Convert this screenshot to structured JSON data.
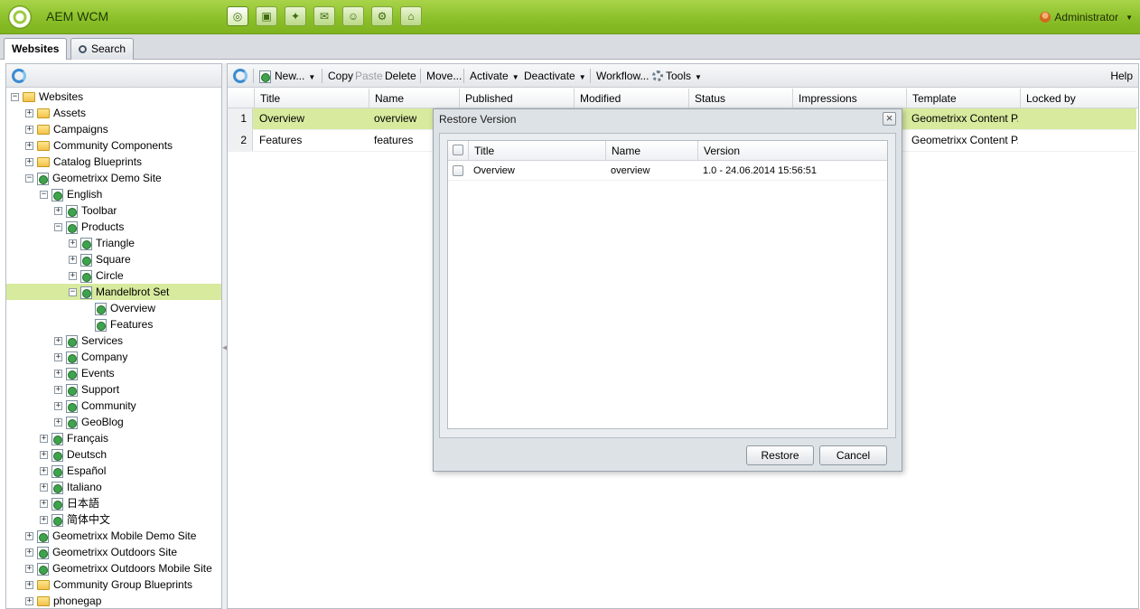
{
  "app": {
    "title": "AEM WCM",
    "user": "Administrator",
    "apps": [
      {
        "icon": "websites-icon",
        "glyph": "◎"
      },
      {
        "icon": "digital-assets-icon",
        "glyph": "▣"
      },
      {
        "icon": "campaigns-icon",
        "glyph": "✦"
      },
      {
        "icon": "inbox-icon",
        "glyph": "✉"
      },
      {
        "icon": "users-icon",
        "glyph": "☺"
      },
      {
        "icon": "tools-icon",
        "glyph": "⚙"
      },
      {
        "icon": "tagging-icon",
        "glyph": "⌂"
      }
    ]
  },
  "tabs": [
    "Websites",
    "Search"
  ],
  "tree": [
    {
      "label": "Websites",
      "depth": 0,
      "icon": "folder",
      "exp": "-"
    },
    {
      "label": "Assets",
      "depth": 1,
      "icon": "folder",
      "exp": "+"
    },
    {
      "label": "Campaigns",
      "depth": 1,
      "icon": "folder",
      "exp": "+"
    },
    {
      "label": "Community Components",
      "depth": 1,
      "icon": "folder",
      "exp": "+"
    },
    {
      "label": "Catalog Blueprints",
      "depth": 1,
      "icon": "folder",
      "exp": "+"
    },
    {
      "label": "Geometrixx Demo Site",
      "depth": 1,
      "icon": "page",
      "exp": "-"
    },
    {
      "label": "English",
      "depth": 2,
      "icon": "page",
      "exp": "-"
    },
    {
      "label": "Toolbar",
      "depth": 3,
      "icon": "page",
      "exp": "+"
    },
    {
      "label": "Products",
      "depth": 3,
      "icon": "page",
      "exp": "-"
    },
    {
      "label": "Triangle",
      "depth": 4,
      "icon": "page",
      "exp": "+"
    },
    {
      "label": "Square",
      "depth": 4,
      "icon": "page",
      "exp": "+"
    },
    {
      "label": "Circle",
      "depth": 4,
      "icon": "page",
      "exp": "+"
    },
    {
      "label": "Mandelbrot Set",
      "depth": 4,
      "icon": "page",
      "exp": "-",
      "selected": true
    },
    {
      "label": "Overview",
      "depth": 5,
      "icon": "page",
      "exp": ""
    },
    {
      "label": "Features",
      "depth": 5,
      "icon": "page",
      "exp": ""
    },
    {
      "label": "Services",
      "depth": 3,
      "icon": "page",
      "exp": "+"
    },
    {
      "label": "Company",
      "depth": 3,
      "icon": "page",
      "exp": "+"
    },
    {
      "label": "Events",
      "depth": 3,
      "icon": "page",
      "exp": "+"
    },
    {
      "label": "Support",
      "depth": 3,
      "icon": "page",
      "exp": "+"
    },
    {
      "label": "Community",
      "depth": 3,
      "icon": "page",
      "exp": "+"
    },
    {
      "label": "GeoBlog",
      "depth": 3,
      "icon": "page",
      "exp": "+"
    },
    {
      "label": "Français",
      "depth": 2,
      "icon": "page",
      "exp": "+"
    },
    {
      "label": "Deutsch",
      "depth": 2,
      "icon": "page",
      "exp": "+"
    },
    {
      "label": "Español",
      "depth": 2,
      "icon": "page",
      "exp": "+"
    },
    {
      "label": "Italiano",
      "depth": 2,
      "icon": "page",
      "exp": "+"
    },
    {
      "label": "日本語",
      "depth": 2,
      "icon": "page",
      "exp": "+"
    },
    {
      "label": "简体中文",
      "depth": 2,
      "icon": "page",
      "exp": "+"
    },
    {
      "label": "Geometrixx Mobile Demo Site",
      "depth": 1,
      "icon": "page",
      "exp": "+"
    },
    {
      "label": "Geometrixx Outdoors Site",
      "depth": 1,
      "icon": "page",
      "exp": "+"
    },
    {
      "label": "Geometrixx Outdoors Mobile Site",
      "depth": 1,
      "icon": "page",
      "exp": "+"
    },
    {
      "label": "Community Group Blueprints",
      "depth": 1,
      "icon": "folder",
      "exp": "+"
    },
    {
      "label": "phonegap",
      "depth": 1,
      "icon": "folder",
      "exp": "+"
    }
  ],
  "toolbar": {
    "new": "New...",
    "copy": "Copy",
    "paste": "Paste",
    "delete": "Delete",
    "move": "Move...",
    "activate": "Activate",
    "deactivate": "Deactivate",
    "workflow": "Workflow...",
    "tools": "Tools",
    "help": "Help"
  },
  "grid": {
    "columns": [
      "Title",
      "Name",
      "Published",
      "Modified",
      "Status",
      "Impressions",
      "Template",
      "Locked by"
    ],
    "rows": [
      {
        "num": "1",
        "title": "Overview",
        "name": "overview",
        "template": "Geometrixx Content P...",
        "selected": true
      },
      {
        "num": "2",
        "title": "Features",
        "name": "features",
        "template": "Geometrixx Content P...",
        "selected": false
      }
    ]
  },
  "dialog": {
    "title": "Restore Version",
    "columns": [
      "Title",
      "Name",
      "Version"
    ],
    "rows": [
      {
        "title": "Overview",
        "name": "overview",
        "version": "1.0 - 24.06.2014 15:56:51"
      }
    ],
    "restore_label": "Restore",
    "cancel_label": "Cancel"
  },
  "colors": {
    "accent_green": "#8cc02a",
    "selection": "#d7ea9e"
  }
}
